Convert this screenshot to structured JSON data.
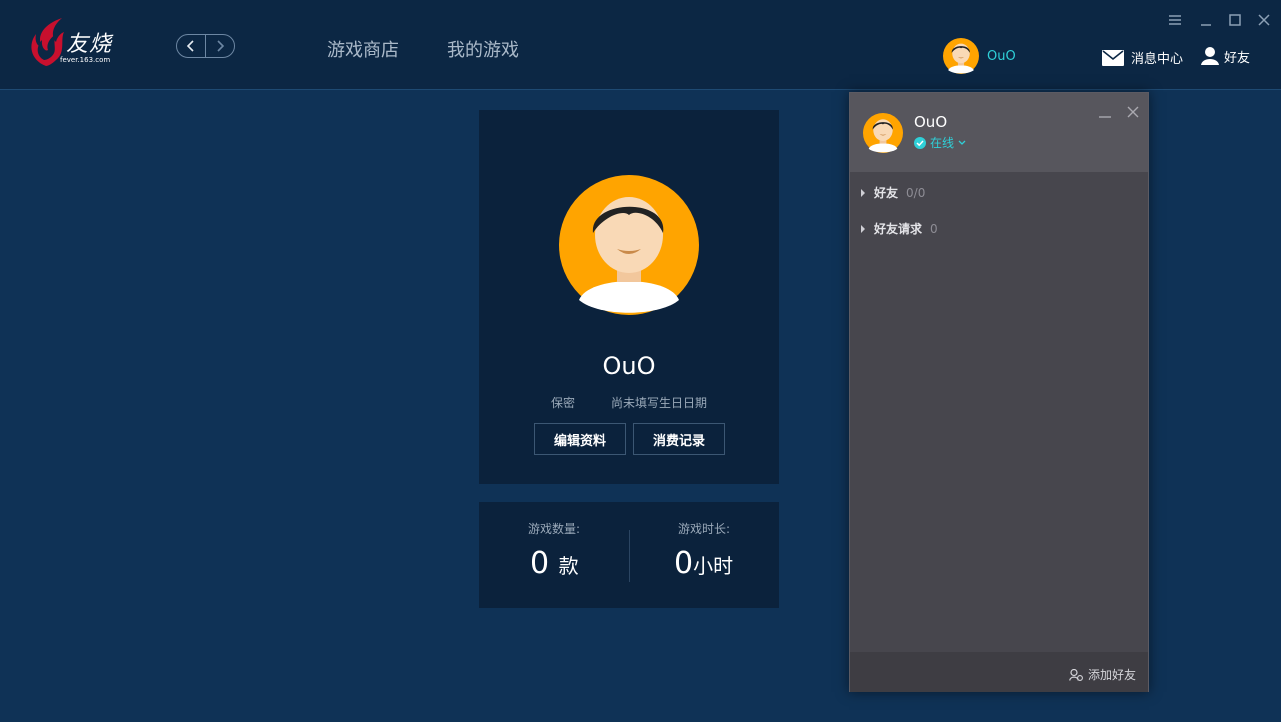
{
  "app": {
    "logo_text": "友烧",
    "logo_sub": "fever.163.com"
  },
  "nav": {
    "back_icon": "chevron-left-icon",
    "forward_icon": "chevron-right-icon",
    "menu_store": "游戏商店",
    "menu_my_games": "我的游戏"
  },
  "header": {
    "username": "OuO",
    "messages_label": "消息中心",
    "friends_label": "好友"
  },
  "profile": {
    "name": "OuO",
    "gender": "保密",
    "birthday": "尚未填写生日日期",
    "edit_label": "编辑资料",
    "records_label": "消费记录"
  },
  "stats": {
    "games_label": "游戏数量:",
    "games_value": "0",
    "games_unit": "款",
    "time_label": "游戏时长:",
    "time_value": "0",
    "time_unit": "小时"
  },
  "friends_panel": {
    "name": "OuO",
    "status": "在线",
    "groups": [
      {
        "label": "好友",
        "count": "0/0"
      },
      {
        "label": "好友请求",
        "count": "0"
      }
    ],
    "add_friend": "添加好友"
  },
  "colors": {
    "accent": "#2fd0d8",
    "avatar_bg": "#ffa400",
    "background": "#0f3256",
    "topbar": "#0c2744"
  }
}
